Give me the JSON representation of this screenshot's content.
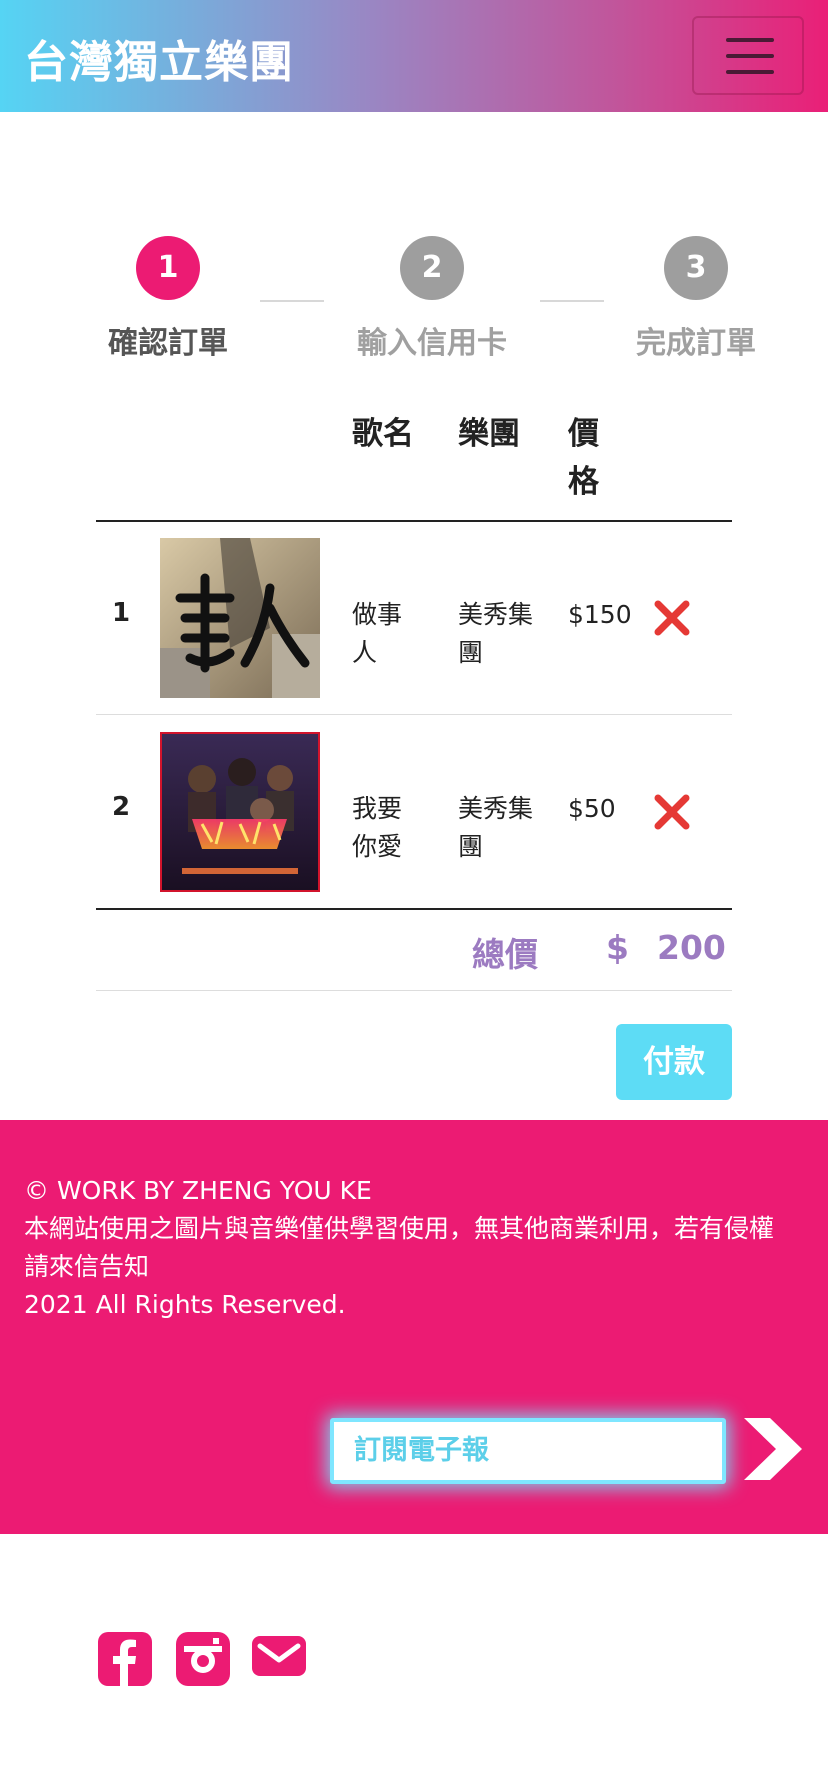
{
  "header": {
    "brand": "台灣獨立樂團",
    "menu_icon": "hamburger-menu-icon"
  },
  "steps": [
    {
      "number": "1",
      "label": "確認訂單",
      "color": "#ec1b73",
      "label_color": "#555555"
    },
    {
      "number": "2",
      "label": "輸入信用卡",
      "color": "#9e9e9e",
      "label_color": "#a0a0a0"
    },
    {
      "number": "3",
      "label": "完成訂單",
      "color": "#9e9e9e",
      "label_color": "#a0a0a0"
    }
  ],
  "table": {
    "headers": {
      "song": "歌名",
      "band": "樂團",
      "price_line1": "價",
      "price_line2": "格"
    },
    "rows": [
      {
        "index": "1",
        "song_line1": "做事",
        "song_line2": "人",
        "band_line1": "美秀集",
        "band_line2": "團",
        "price": "$150",
        "cover": "album-cover-zuo-shi-ren"
      },
      {
        "index": "2",
        "song_line1": "我要",
        "song_line2": "你愛",
        "band_line1": "美秀集",
        "band_line2": "團",
        "price": "$50",
        "cover": "album-cover-wo-yao-ni-ai"
      }
    ],
    "total_label": "總價",
    "total_currency": "$",
    "total_value": "200"
  },
  "pay_button": "付款",
  "footer": {
    "line1": "© WORK BY ZHENG YOU KE",
    "line2": "本網站使用之圖片與音樂僅供學習使用，無其他商業利用，若有侵權",
    "line3": "請來信告知",
    "line4": "2021 All Rights Reserved.",
    "subscribe_placeholder": "訂閱電子報",
    "submit_icon": "chevron-right-icon"
  },
  "social": [
    "facebook-icon",
    "instagram-icon",
    "mail-icon"
  ],
  "colors": {
    "brand_pink": "#ec1b73",
    "accent_cyan": "#5ddcf5",
    "total_purple": "#9c7bc1",
    "remove_red": "#e53935"
  }
}
